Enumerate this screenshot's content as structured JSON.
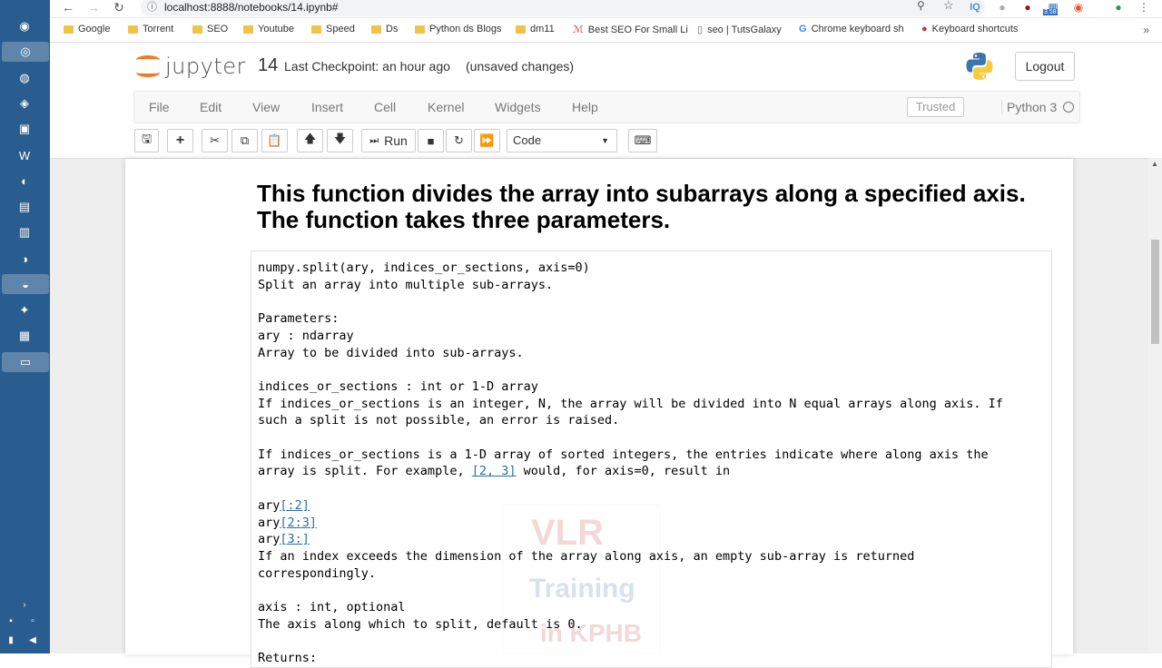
{
  "browser": {
    "url": "localhost:8888/notebooks/14.ipynb#",
    "bookmarks": [
      "Google",
      "Torrent",
      "SEO",
      "Youtube",
      "Speed",
      "Ds",
      "Python ds Blogs",
      "dm11",
      "Best SEO For Small Li",
      "seo | TutsGalaxy",
      "Chrome keyboard sh",
      "Keyboard shortcuts"
    ],
    "more": "»",
    "ext_badge": "3.58"
  },
  "header": {
    "logo_text": "jupyter",
    "notebook_name": "14",
    "checkpoint": "Last Checkpoint: an hour ago",
    "unsaved": "(unsaved changes)",
    "logout": "Logout"
  },
  "menubar": {
    "items": [
      "File",
      "Edit",
      "View",
      "Insert",
      "Cell",
      "Kernel",
      "Widgets",
      "Help"
    ],
    "trusted": "Trusted",
    "kernel": "Python 3"
  },
  "toolbar": {
    "run_label": "Run",
    "cell_type": "Code"
  },
  "notebook": {
    "heading": "This function divides the array into subarrays along a specified axis. The function takes three parameters.",
    "doc_lines": [
      "numpy.split(ary, indices_or_sections, axis=0)",
      "Split an array into multiple sub-arrays.",
      "",
      "Parameters:",
      "ary : ndarray",
      "Array to be divided into sub-arrays.",
      "",
      "indices_or_sections : int or 1-D array",
      "If indices_or_sections is an integer, N, the array will be divided into N equal arrays along axis. If",
      "such a split is not possible, an error is raised.",
      "",
      "If indices_or_sections is a 1-D array of sorted integers, the entries indicate where along axis the",
      "array is split. For example, ",
      "",
      "ary",
      "ary",
      "ary",
      "If an index exceeds the dimension of the array along axis, an empty sub-array is returned",
      "correspondingly.",
      "",
      "axis : int, optional",
      "The axis along which to split, default is 0.",
      "",
      "Returns:"
    ],
    "example_link": "[2, 3]",
    "example_tail": " would, for axis=0, result in",
    "slice_links": [
      "[:2]",
      "[2:3]",
      "[3:]"
    ]
  },
  "watermark": {
    "line1": "VLR",
    "line2": "Training",
    "line3": "in KPHB"
  }
}
